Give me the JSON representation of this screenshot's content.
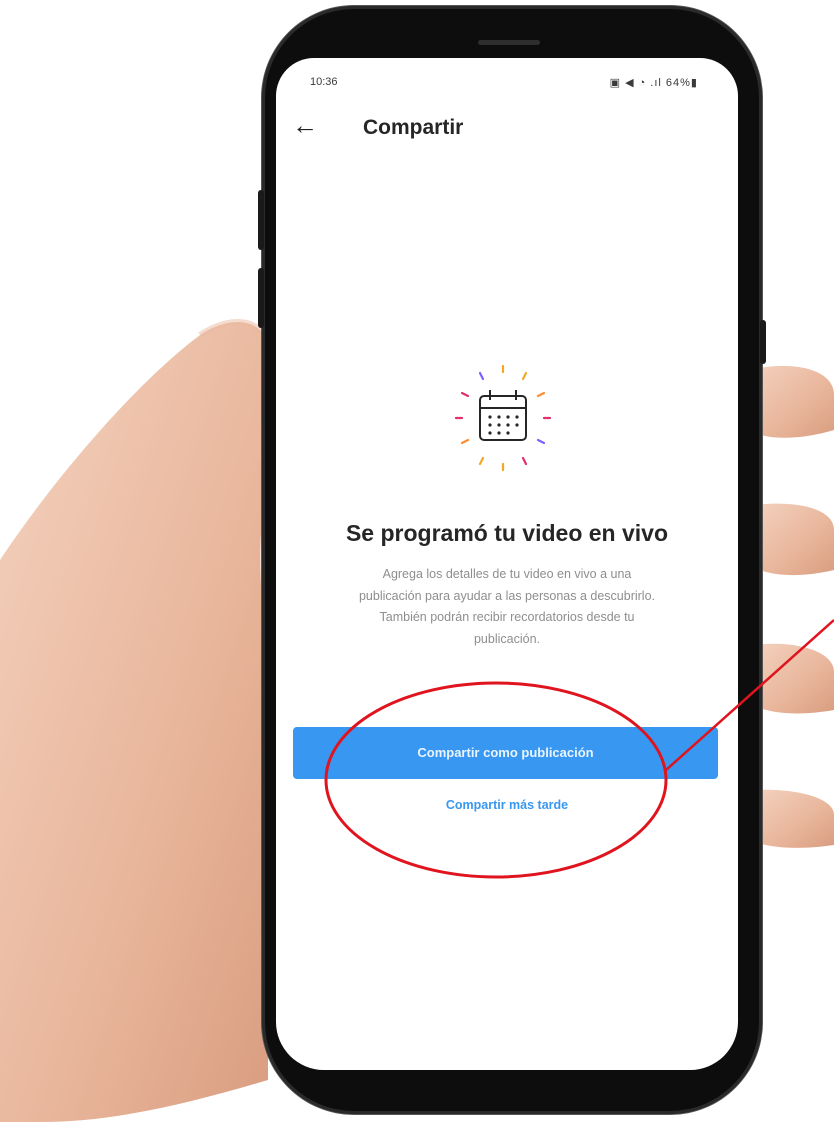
{
  "status_bar": {
    "time": "10:36",
    "icons_text": "▣ ◀ ◔ .ıl 64%▮"
  },
  "header": {
    "back_icon": "arrow-left",
    "title": "Compartir"
  },
  "main": {
    "icon": "calendar-icon",
    "headline": "Se programó tu video en vivo",
    "description": "Agrega los detalles de tu video en vivo a una publicación para ayudar a las personas a descubrirlo. También podrán recibir recordatorios desde tu publicación."
  },
  "actions": {
    "primary_label": "Compartir como publicación",
    "secondary_label": "Compartir más tarde"
  },
  "colors": {
    "accent": "#3897f0",
    "annotation": "#e0141e"
  }
}
